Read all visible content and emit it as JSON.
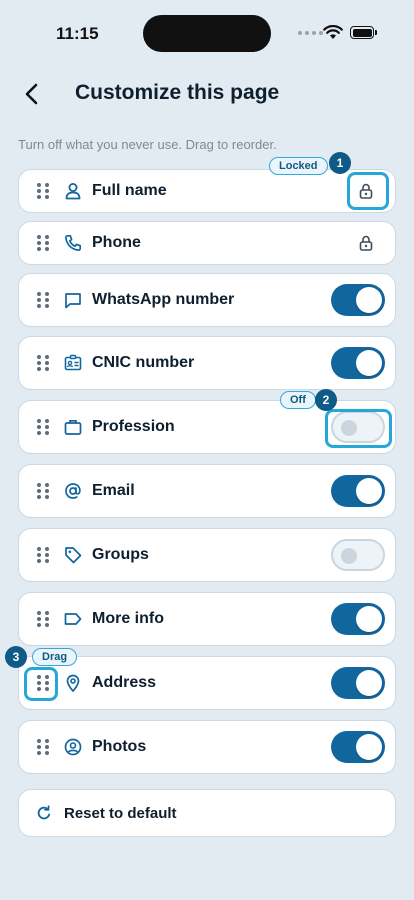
{
  "status_bar": {
    "time": "11:15"
  },
  "header": {
    "title": "Customize this page",
    "back_icon": "chevron-left-icon"
  },
  "hint": "Turn off what you never use. Drag to reorder.",
  "fields": [
    {
      "label": "Full name",
      "icon": "person-icon",
      "control": "locked"
    },
    {
      "label": "Phone",
      "icon": "phone-icon",
      "control": "locked"
    },
    {
      "label": "WhatsApp number",
      "icon": "chat-icon",
      "control": "toggle",
      "on": true
    },
    {
      "label": "CNIC number",
      "icon": "id-card-icon",
      "control": "toggle",
      "on": true
    },
    {
      "label": "Profession",
      "icon": "briefcase-icon",
      "control": "toggle",
      "on": false
    },
    {
      "label": "Email",
      "icon": "at-icon",
      "control": "toggle",
      "on": true
    },
    {
      "label": "Groups",
      "icon": "tag-icon",
      "control": "toggle",
      "on": false
    },
    {
      "label": "More info",
      "icon": "label-icon",
      "control": "toggle",
      "on": true
    },
    {
      "label": "Address",
      "icon": "location-pin-icon",
      "control": "toggle",
      "on": true
    },
    {
      "label": "Photos",
      "icon": "user-circle-icon",
      "control": "toggle",
      "on": true
    }
  ],
  "annotations": [
    {
      "number": "1",
      "label": "Locked"
    },
    {
      "number": "2",
      "label": "Off"
    },
    {
      "number": "3",
      "label": "Drag"
    }
  ],
  "reset": {
    "label": "Reset to default",
    "icon": "refresh-icon"
  },
  "colors": {
    "accent": "#12669e",
    "highlight": "#27a6d8",
    "badge": "#0f5a86",
    "background": "#e3ebf2"
  }
}
